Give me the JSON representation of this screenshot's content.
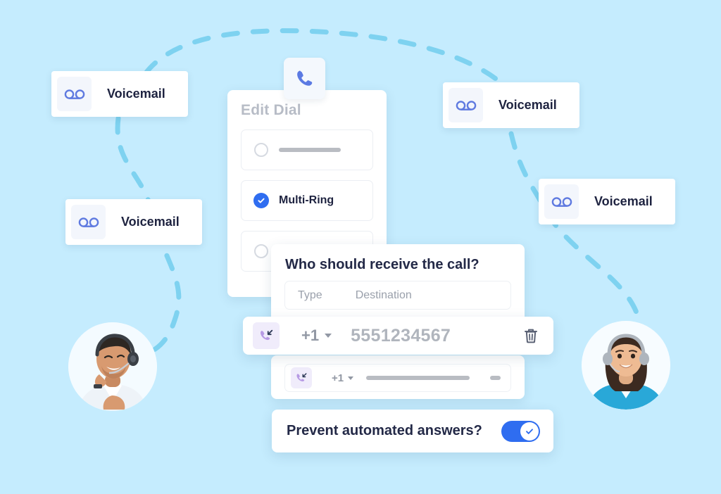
{
  "page": {
    "background_color": "#c5ecfe",
    "dashed_line_color": "#7ed2f0",
    "accent_blue": "#2f6df0",
    "accent_purple": "#a98be0",
    "heading_color": "#232947",
    "muted_color": "#9aa0ab"
  },
  "voicemail_cards": [
    {
      "label": "Voicemail",
      "icon": "voicemail-icon"
    },
    {
      "label": "Voicemail",
      "icon": "voicemail-icon"
    },
    {
      "label": "Voicemail",
      "icon": "voicemail-icon"
    },
    {
      "label": "Voicemail",
      "icon": "voicemail-icon"
    }
  ],
  "edit_dial": {
    "title": "Edit Dial",
    "header_icon": "phone-icon",
    "options": [
      {
        "label": "",
        "selected": false,
        "placeholder_bar": true
      },
      {
        "label": "Multi-Ring",
        "selected": true,
        "placeholder_bar": false
      },
      {
        "label": "",
        "selected": false,
        "placeholder_bar": false
      }
    ]
  },
  "receive_call": {
    "title": "Who should receive the call?",
    "columns": {
      "type": "Type",
      "destination": "Destination"
    }
  },
  "destinations": [
    {
      "icon": "incoming-call-icon",
      "country_code": "+1",
      "number": "5551234567",
      "delete_icon": "trash-icon"
    },
    {
      "icon": "incoming-call-icon",
      "country_code": "+1",
      "number": "",
      "delete_icon": "minus-icon"
    }
  ],
  "prevent_automated": {
    "label": "Prevent automated answers?",
    "toggle_on": true,
    "toggle_icon": "check-icon"
  },
  "avatars": [
    {
      "name": "agent-left",
      "description": "Smiling man wearing a headset"
    },
    {
      "name": "agent-right",
      "description": "Smiling woman wearing a headset"
    }
  ]
}
